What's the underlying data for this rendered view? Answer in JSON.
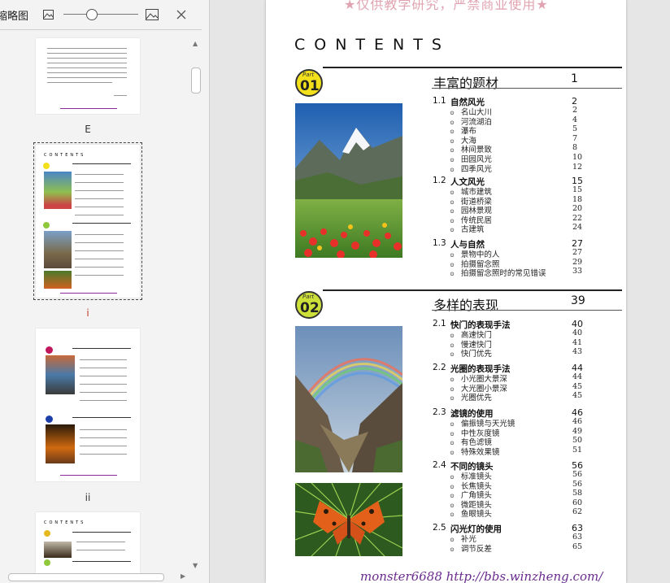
{
  "sidebar": {
    "title": "缩略图",
    "icons": [
      "image-small-icon",
      "image-large-icon",
      "close-icon"
    ],
    "thumb_labels": [
      "E",
      "i",
      "ii"
    ],
    "contents_mini": "CONTENTS"
  },
  "document": {
    "watermark_top": "★仅供教学研究，严禁商业使用★",
    "contents_title": "CONTENTS",
    "part_label": "Part",
    "parts": [
      {
        "number": "01",
        "title": "丰富的题材",
        "page": "1",
        "sections": [
          {
            "num": "1.1",
            "title": "自然风光",
            "page": "2",
            "entries": [
              [
                "名山大川",
                "2"
              ],
              [
                "河流湖泊",
                "4"
              ],
              [
                "瀑布",
                "5"
              ],
              [
                "大海",
                "7"
              ],
              [
                "林间景致",
                "8"
              ],
              [
                "田园风光",
                "10"
              ],
              [
                "四季风光",
                "12"
              ]
            ]
          },
          {
            "num": "1.2",
            "title": "人文风光",
            "page": "15",
            "entries": [
              [
                "城市建筑",
                "15"
              ],
              [
                "街道桥梁",
                "18"
              ],
              [
                "园林景观",
                "20"
              ],
              [
                "传统民居",
                "22"
              ],
              [
                "古建筑",
                "24"
              ]
            ]
          },
          {
            "num": "1.3",
            "title": "人与自然",
            "page": "27",
            "entries": [
              [
                "景物中的人",
                "27"
              ],
              [
                "拍摄留念照",
                "29"
              ],
              [
                "拍摄留念照时的常见错误",
                "33"
              ]
            ]
          }
        ]
      },
      {
        "number": "02",
        "title": "多样的表现",
        "page": "39",
        "sections": [
          {
            "num": "2.1",
            "title": "快门的表现手法",
            "page": "40",
            "entries": [
              [
                "高速快门",
                "40"
              ],
              [
                "慢速快门",
                "41"
              ],
              [
                "快门优先",
                "43"
              ]
            ]
          },
          {
            "num": "2.2",
            "title": "光圈的表现手法",
            "page": "44",
            "entries": [
              [
                "小光圈大景深",
                "44"
              ],
              [
                "大光圈小景深",
                "45"
              ],
              [
                "光圈优先",
                "45"
              ]
            ]
          },
          {
            "num": "2.3",
            "title": "滤镜的使用",
            "page": "46",
            "entries": [
              [
                "偏振镜与天光镜",
                "46"
              ],
              [
                "中性灰度镜",
                "49"
              ],
              [
                "有色滤镜",
                "50"
              ],
              [
                "特殊效果镜",
                "51"
              ]
            ]
          },
          {
            "num": "2.4",
            "title": "不同的镜头",
            "page": "56",
            "entries": [
              [
                "标准镜头",
                "56"
              ],
              [
                "长焦镜头",
                "56"
              ],
              [
                "广角镜头",
                "58"
              ],
              [
                "微距镜头",
                "60"
              ],
              [
                "鱼眼镜头",
                "62"
              ]
            ]
          },
          {
            "num": "2.5",
            "title": "闪光灯的使用",
            "page": "63",
            "entries": [
              [
                "补光",
                "63"
              ],
              [
                "调节反差",
                "65"
              ]
            ]
          }
        ]
      }
    ],
    "footer_watermark": "monster6688 http://bbs.winzheng.com/",
    "bullet": "⊙"
  }
}
